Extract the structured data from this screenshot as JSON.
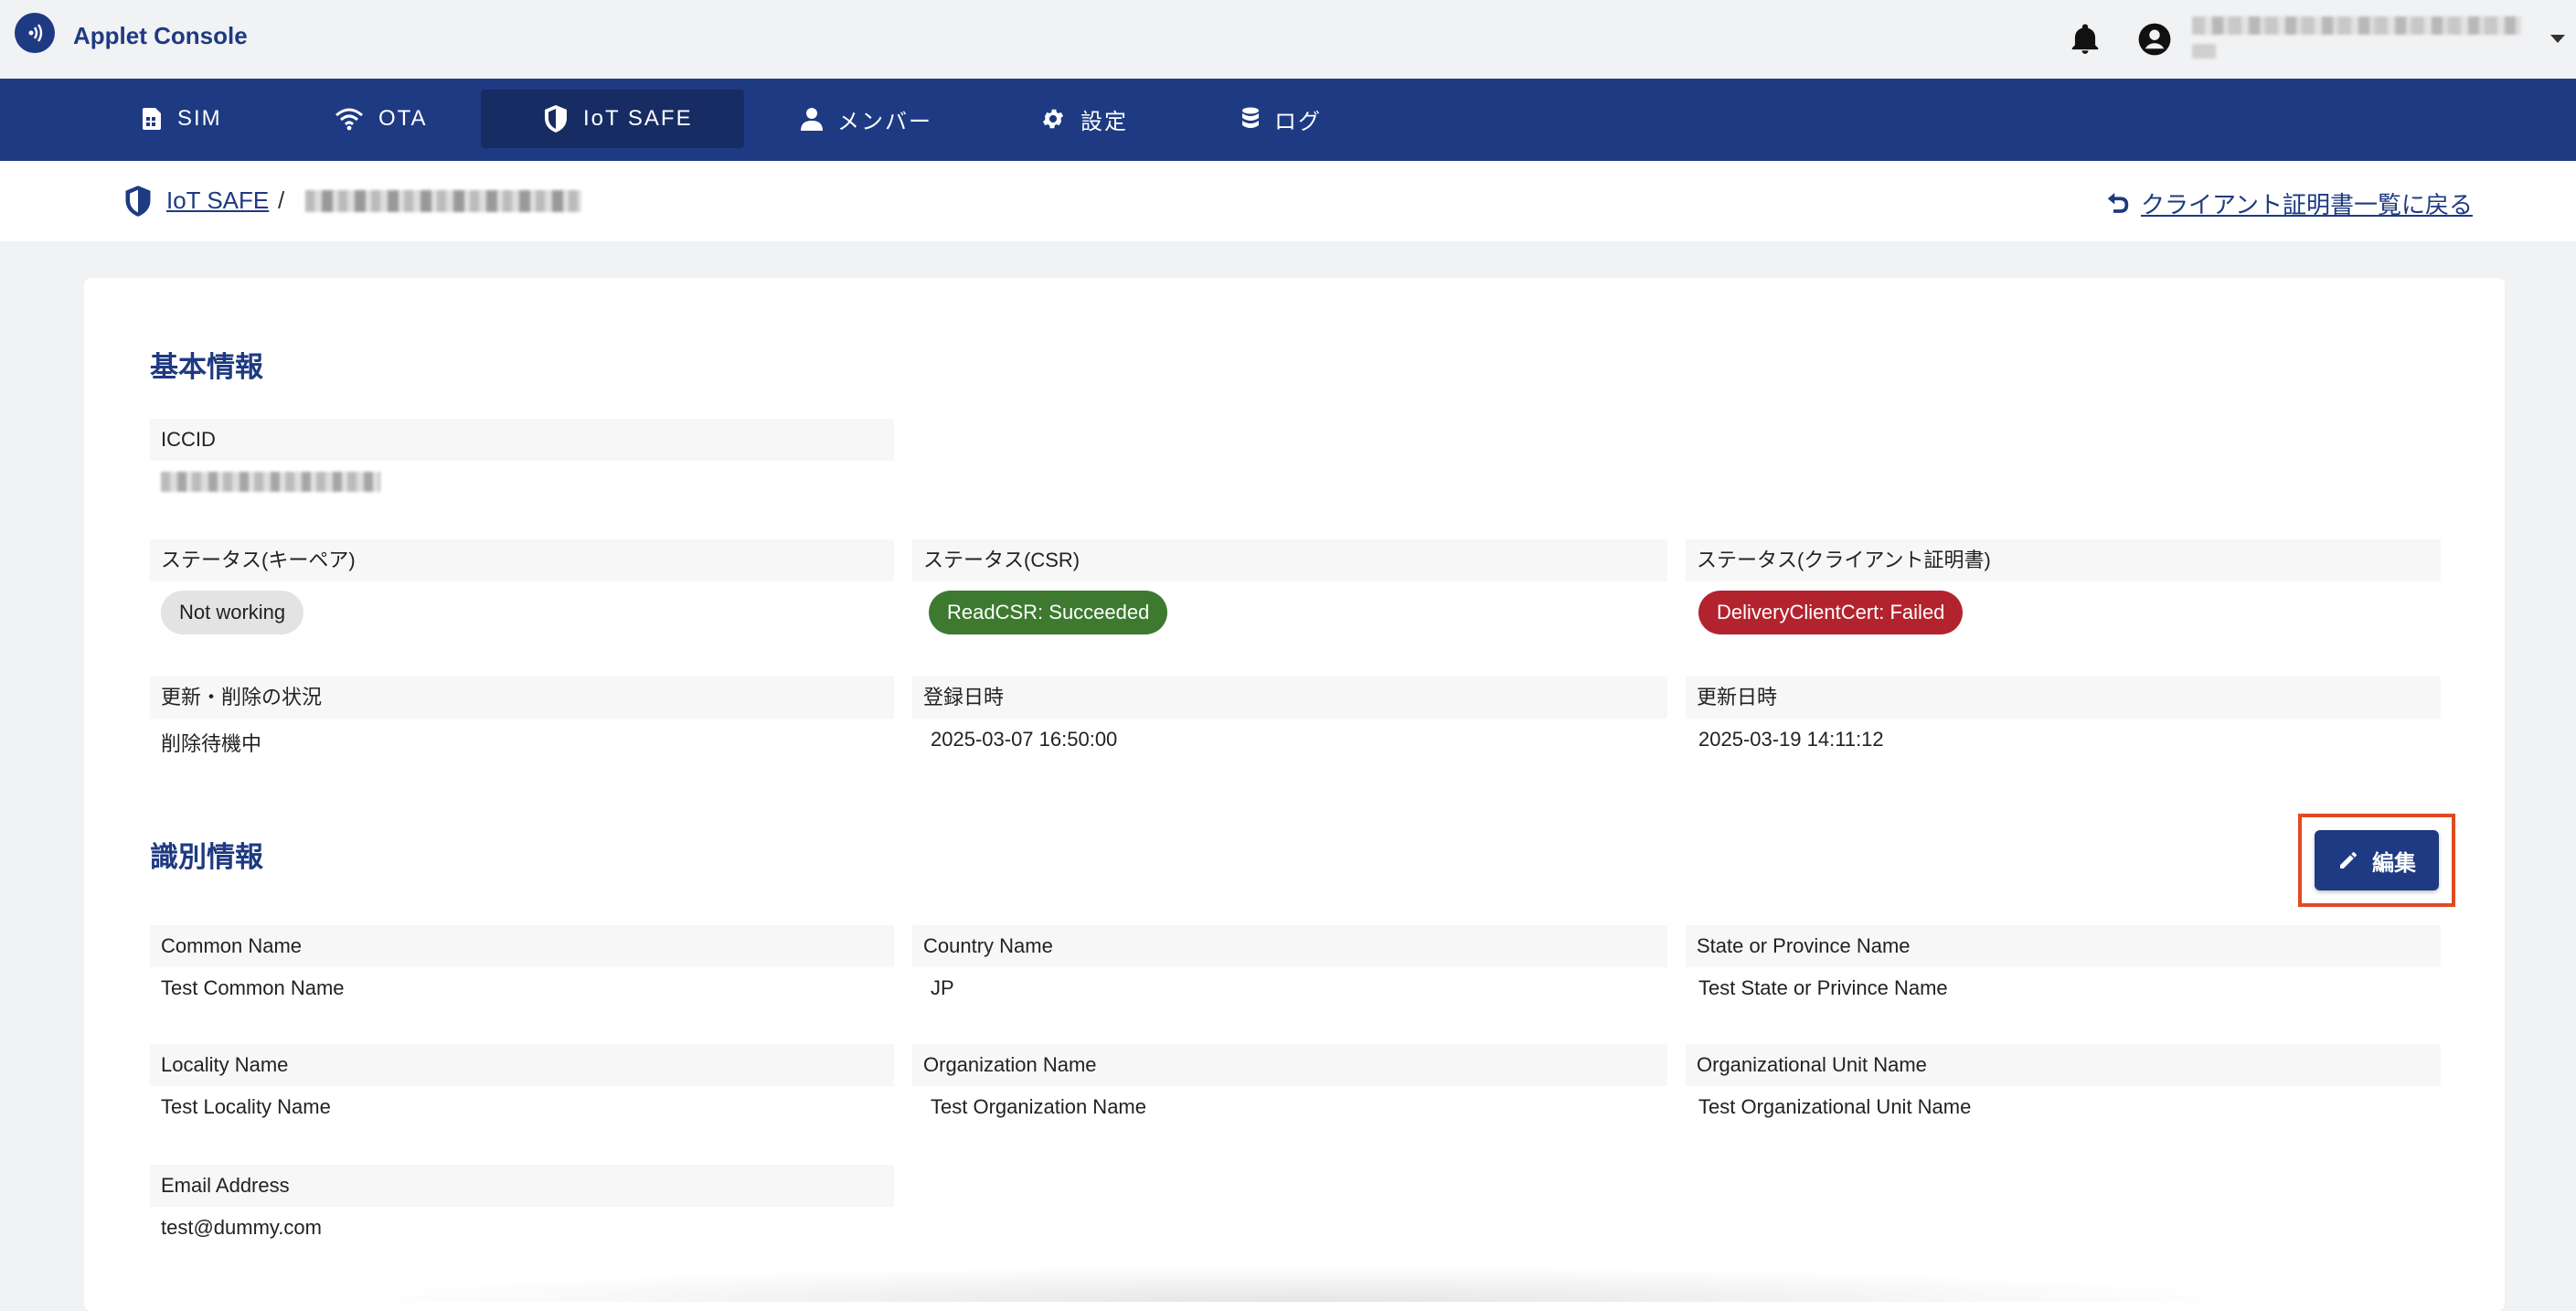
{
  "app": {
    "title": "Applet Console"
  },
  "nav": {
    "items": [
      {
        "label": "SIM",
        "icon": "sim-card-icon"
      },
      {
        "label": "OTA",
        "icon": "wifi-icon"
      },
      {
        "label": "IoT SAFE",
        "icon": "shield-icon",
        "active": true
      },
      {
        "label": "メンバー",
        "icon": "person-icon"
      },
      {
        "label": "設定",
        "icon": "gear-icon"
      },
      {
        "label": "ログ",
        "icon": "database-icon"
      }
    ]
  },
  "breadcrumb": {
    "root": "IoT SAFE",
    "separator": "/",
    "back_link": "クライアント証明書一覧に戻る"
  },
  "basic_info": {
    "title": "基本情報",
    "iccid_label": "ICCID",
    "keypair_status_label": "ステータス(キーペア)",
    "keypair_status_value": "Not working",
    "csr_status_label": "ステータス(CSR)",
    "csr_status_value": "ReadCSR: Succeeded",
    "cert_status_label": "ステータス(クライアント証明書)",
    "cert_status_value": "DeliveryClientCert: Failed",
    "update_delete_label": "更新・削除の状況",
    "update_delete_value": "削除待機中",
    "registered_label": "登録日時",
    "registered_value": "2025-03-07 16:50:00",
    "updated_label": "更新日時",
    "updated_value": "2025-03-19 14:11:12"
  },
  "identity_info": {
    "title": "識別情報",
    "edit_label": "編集",
    "common_name_label": "Common Name",
    "common_name_value": "Test Common Name",
    "country_label": "Country Name",
    "country_value": "JP",
    "state_label": "State or Province Name",
    "state_value": "Test State or Privince Name",
    "locality_label": "Locality Name",
    "locality_value": "Test Locality Name",
    "org_label": "Organization Name",
    "org_value": "Test Organization Name",
    "org_unit_label": "Organizational Unit Name",
    "org_unit_value": "Test Organizational Unit Name",
    "email_label": "Email Address",
    "email_value": "test@dummy.com"
  },
  "colors": {
    "primary": "#1e3a82",
    "success": "#3d7a30",
    "danger": "#b3232e",
    "highlight": "#e04a23"
  }
}
